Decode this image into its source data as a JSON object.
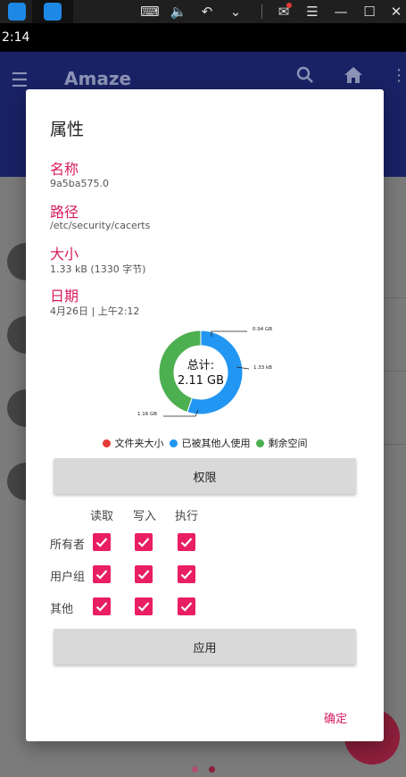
{
  "status_bar": {
    "time": "2:14"
  },
  "app": {
    "title": "Amaze"
  },
  "dialog": {
    "title": "属性",
    "name_label": "名称",
    "name_value": "9a5ba575.0",
    "path_label": "路径",
    "path_value": "/etc/security/cacerts",
    "size_label": "大小",
    "size_value": "1.33 kB (1330 字节)",
    "date_label": "日期",
    "date_value": "4月26日 | 上午2:12",
    "permissions_button": "权限",
    "apply_button": "应用",
    "ok_button": "确定"
  },
  "chart_data": {
    "type": "pie",
    "center_label": "总计:",
    "center_value": "2.11 GB",
    "slices": [
      {
        "name": "文件夹大小",
        "label": "1.33 kB",
        "value": 0.0,
        "color": "#e53935"
      },
      {
        "name": "已被其他人使用",
        "label": "1.16 GB",
        "value": 1.16,
        "color": "#2196f3"
      },
      {
        "name": "剩余空间",
        "label": "0.94 GB",
        "value": 0.94,
        "color": "#4caf50"
      }
    ]
  },
  "permissions": {
    "columns": [
      "读取",
      "写入",
      "执行"
    ],
    "rows": [
      {
        "label": "所有者",
        "values": [
          true,
          true,
          true
        ]
      },
      {
        "label": "用户组",
        "values": [
          true,
          true,
          true
        ]
      },
      {
        "label": "其他",
        "values": [
          true,
          true,
          true
        ]
      }
    ]
  },
  "colors": {
    "accent": "#d81b60",
    "checkbox": "#e91e63",
    "toolbar": "#1a2266"
  }
}
